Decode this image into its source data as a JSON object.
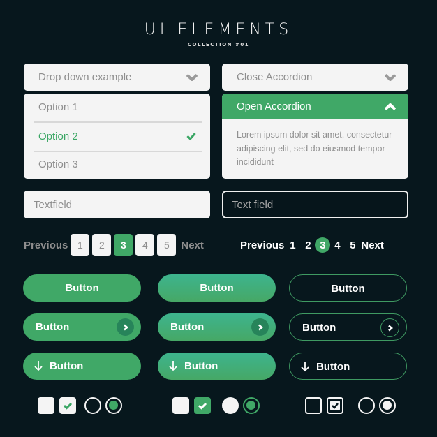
{
  "header": {
    "title": "UI ELEMENTS",
    "subtitle": "COLLECTION #01"
  },
  "dropdown": {
    "label": "Drop down example",
    "options": [
      {
        "label": "Option 1",
        "selected": false
      },
      {
        "label": "Option 2",
        "selected": true
      },
      {
        "label": "Option 3",
        "selected": false
      }
    ]
  },
  "accordion": {
    "closed_label": "Close Accordion",
    "open_label": "Open Accordion",
    "open_body": "Lorem ipsum dolor sit amet, consectetur adipiscing elit, sed do eiusmod tempor incididunt"
  },
  "textfields": {
    "light_placeholder": "Textfield",
    "dark_placeholder": "Text field"
  },
  "pagination_boxed": {
    "previous": "Previous",
    "next": "Next",
    "pages": [
      "1",
      "2",
      "3",
      "4",
      "5"
    ],
    "current": "3"
  },
  "pagination_plain": {
    "previous": "Previous",
    "next": "Next",
    "pages": [
      "1",
      "2",
      "3",
      "4",
      "5"
    ],
    "current": "3"
  },
  "buttons": {
    "solid": {
      "plain": "Button",
      "with_arrow": "Button",
      "with_download": "Button"
    },
    "gradient": {
      "plain": "Button",
      "with_arrow": "Button",
      "with_download": "Button"
    },
    "outline": {
      "plain": "Button",
      "with_arrow": "Button",
      "with_download": "Button"
    }
  },
  "controls": {
    "light": {
      "checkbox_unchecked": false,
      "checkbox_checked": true,
      "radio_unselected": false,
      "radio_selected": true
    },
    "green": {
      "checkbox_unchecked": false,
      "checkbox_checked": true,
      "radio_unselected": false,
      "radio_selected": true
    },
    "outline": {
      "checkbox_unchecked": false,
      "checkbox_checked": true,
      "radio_unselected": false,
      "radio_selected": true
    }
  },
  "colors": {
    "background": "#07171d",
    "accent": "#40a867",
    "card": "#f4f4f4",
    "muted_text": "#8e8e8e"
  }
}
